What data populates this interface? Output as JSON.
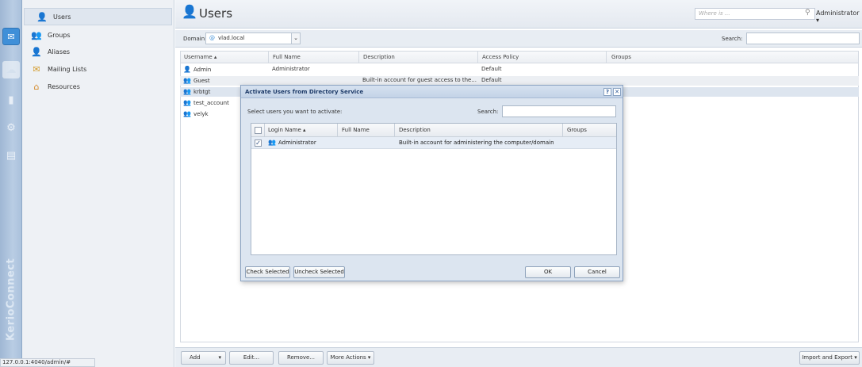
{
  "app": {
    "brand": "KerioConnect",
    "status_url": "127.0.0.1:4040/admin/#"
  },
  "sidebar": {
    "items": [
      {
        "label": "Users",
        "icon": "user-icon"
      },
      {
        "label": "Groups",
        "icon": "group-icon"
      },
      {
        "label": "Aliases",
        "icon": "alias-icon"
      },
      {
        "label": "Mailing Lists",
        "icon": "mailing-list-icon"
      },
      {
        "label": "Resources",
        "icon": "resource-icon"
      }
    ]
  },
  "header": {
    "title": "Users",
    "where_placeholder": "Where is ...",
    "user_menu": "Administrator ▾"
  },
  "toolbar": {
    "domain_label": "Domain:",
    "domain_value": "vlad.local",
    "search_label": "Search:"
  },
  "grid": {
    "columns": [
      "Username ▴",
      "Full Name",
      "Description",
      "Access Policy",
      "Groups"
    ],
    "rows": [
      {
        "username": "Admin",
        "full_name": "Administrator",
        "description": "",
        "policy": "Default",
        "groups": ""
      },
      {
        "username": "Guest",
        "full_name": "",
        "description": "Built-in account for guest access to the...",
        "policy": "Default",
        "groups": ""
      },
      {
        "username": "krbtgt",
        "full_name": "",
        "description": "",
        "policy": "",
        "groups": ""
      },
      {
        "username": "test_account",
        "full_name": "",
        "description": "",
        "policy": "",
        "groups": ""
      },
      {
        "username": "velyk",
        "full_name": "",
        "description": "",
        "policy": "",
        "groups": ""
      }
    ]
  },
  "bottombar": {
    "add": "Add",
    "edit": "Edit...",
    "remove": "Remove...",
    "more_actions": "More Actions ▾",
    "import_export": "Import and Export ▾"
  },
  "dialog": {
    "title": "Activate Users from Directory Service",
    "help": "?",
    "close": "✕",
    "prompt": "Select users you want to activate:",
    "search_label": "Search:",
    "columns": [
      "Login Name ▴",
      "Full Name",
      "Description",
      "Groups"
    ],
    "rows": [
      {
        "checked": true,
        "login": "Administrator",
        "full_name": "",
        "description": "Built-in account for administering the computer/domain",
        "groups": ""
      }
    ],
    "check_selected": "Check Selected",
    "uncheck_selected": "Uncheck Selected",
    "ok": "OK",
    "cancel": "Cancel"
  },
  "colors": {
    "accent": "#3f8fd8",
    "dialog_bg": "#dce5f0",
    "selection": "#e6edf6"
  }
}
